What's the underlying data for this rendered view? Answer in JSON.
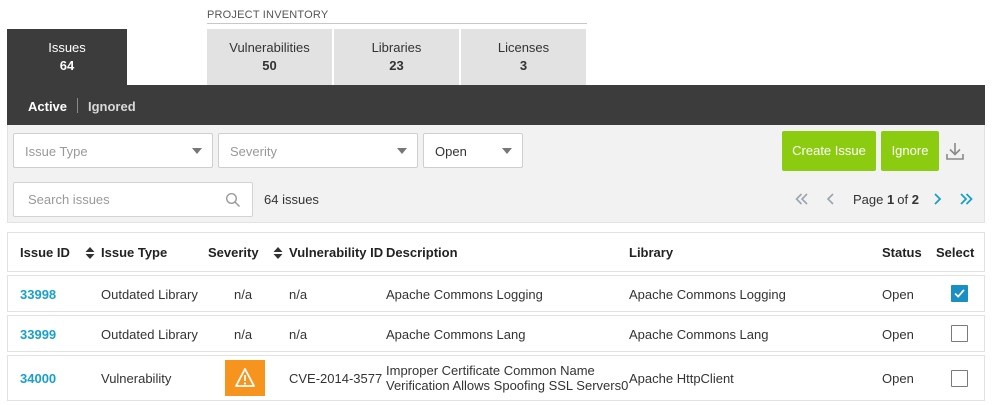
{
  "tabs": {
    "issues": {
      "label": "Issues",
      "count": "64"
    },
    "inventory_title": "PROJECT INVENTORY",
    "inventory": [
      {
        "label": "Vulnerabilities",
        "count": "50"
      },
      {
        "label": "Libraries",
        "count": "23"
      },
      {
        "label": "Licenses",
        "count": "3"
      }
    ]
  },
  "subtabs": {
    "active": "Active",
    "ignored": "Ignored"
  },
  "filters": {
    "issue_type_placeholder": "Issue Type",
    "severity_placeholder": "Severity",
    "status_value": "Open"
  },
  "actions": {
    "create_issue": "Create Issue",
    "ignore": "Ignore"
  },
  "search": {
    "placeholder": "Search issues",
    "count_text": "64 issues"
  },
  "pager": {
    "page_prefix": "Page",
    "current": "1",
    "of": "of",
    "total": "2"
  },
  "table": {
    "headers": {
      "issue_id": "Issue ID",
      "issue_type": "Issue Type",
      "severity": "Severity",
      "vulnerability_id": "Vulnerability ID",
      "description": "Description",
      "library": "Library",
      "status": "Status",
      "select": "Select"
    },
    "rows": [
      {
        "id": "33998",
        "type": "Outdated Library",
        "severity": "n/a",
        "vuln_id": "n/a",
        "description": "Apache Commons Logging",
        "library": "Apache Commons Logging",
        "status": "Open",
        "selected": true
      },
      {
        "id": "33999",
        "type": "Outdated Library",
        "severity": "n/a",
        "vuln_id": "n/a",
        "description": "Apache Commons Lang",
        "library": "Apache Commons Lang",
        "status": "Open",
        "selected": false
      },
      {
        "id": "34000",
        "type": "Vulnerability",
        "severity": "warning",
        "vuln_id": "CVE-2014-3577",
        "description_line1": "Improper Certificate Common Name",
        "description_line2": "Verification Allows Spoofing SSL Servers0",
        "library": "Apache HttpClient",
        "status": "Open",
        "selected": false
      }
    ]
  },
  "colors": {
    "dark": "#3c3c3c",
    "accent_green": "#8bcc10",
    "link_blue": "#1a9fc9",
    "warning_orange": "#f7941d",
    "checkbox_blue": "#1a8fc3"
  },
  "icons": {
    "sort": "sort-icon",
    "search": "search-icon",
    "download": "download-icon",
    "first_page": "double-chevron-left-icon",
    "prev_page": "chevron-left-icon",
    "next_page": "chevron-right-icon",
    "last_page": "double-chevron-right-icon",
    "warning": "warning-icon",
    "check": "check-icon"
  }
}
